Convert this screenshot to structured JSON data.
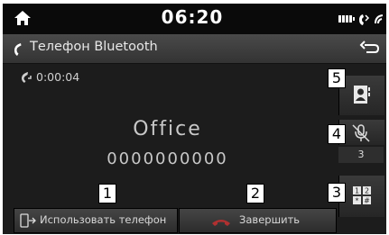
{
  "status": {
    "time": "06:20"
  },
  "title": {
    "text": "Телефон Bluetooth"
  },
  "call": {
    "duration": "0:00:04",
    "name": "Office",
    "number": "0000000000"
  },
  "buttons": {
    "use_phone_label": "Использовать телефон",
    "end_label": "Завершить",
    "mute_count": "3"
  },
  "callouts": [
    "1",
    "2",
    "3",
    "4",
    "5"
  ],
  "colors": {
    "background": "#1c1c1c",
    "text": "#c8c8c8",
    "end_icon": "#b03030"
  }
}
